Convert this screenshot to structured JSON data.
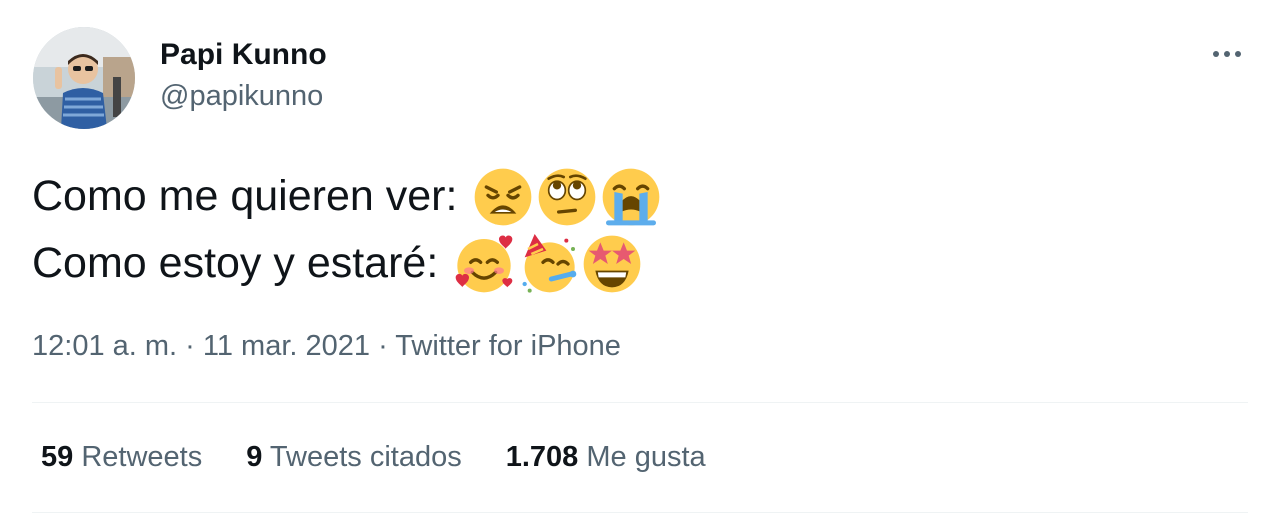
{
  "author": {
    "display_name": "Papi Kunno",
    "handle": "@papikunno"
  },
  "tweet": {
    "line1_text": "Como me quieren ver:",
    "line1_emojis": [
      "weary-face-emoji",
      "face-with-rolling-eyes-emoji",
      "loudly-crying-face-emoji"
    ],
    "line2_text": "Como estoy y estaré:",
    "line2_emojis": [
      "smiling-face-with-hearts-emoji",
      "partying-face-emoji",
      "star-struck-emoji"
    ]
  },
  "meta": {
    "time": "12:01 a. m.",
    "separator": " · ",
    "date": "11 mar. 2021",
    "source": "Twitter for iPhone"
  },
  "stats": {
    "retweets_count": "59",
    "retweets_label": "Retweets",
    "quotes_count": "9",
    "quotes_label": "Tweets citados",
    "likes_count": "1.708",
    "likes_label": "Me gusta"
  },
  "colors": {
    "text_primary": "#0f1419",
    "text_secondary": "#536471",
    "divider": "#eff3f4",
    "emoji_yellow": "#FFCC4D"
  }
}
